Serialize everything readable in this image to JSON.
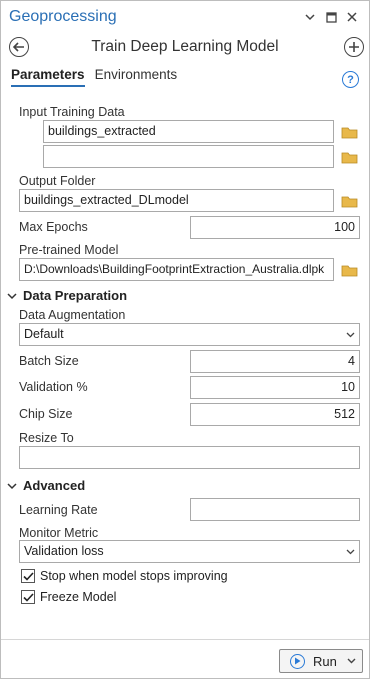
{
  "window": {
    "title": "Geoprocessing"
  },
  "tool": {
    "title": "Train Deep Learning Model"
  },
  "tabs": [
    "Parameters",
    "Environments"
  ],
  "params": {
    "input_training_data": {
      "label": "Input Training Data",
      "values": [
        "buildings_extracted",
        ""
      ]
    },
    "output_folder": {
      "label": "Output Folder",
      "value": "buildings_extracted_DLmodel"
    },
    "max_epochs": {
      "label": "Max Epochs",
      "value": "100"
    },
    "pretrained_model": {
      "label": "Pre-trained Model",
      "value": "D:\\Downloads\\BuildingFootprintExtraction_Australia.dlpk"
    }
  },
  "data_preparation": {
    "header": "Data Preparation",
    "data_augmentation": {
      "label": "Data Augmentation",
      "selected": "Default"
    },
    "batch_size": {
      "label": "Batch Size",
      "value": "4"
    },
    "validation": {
      "label": "Validation %",
      "value": "10"
    },
    "chip_size": {
      "label": "Chip Size",
      "value": "512"
    },
    "resize_to": {
      "label": "Resize To",
      "value": ""
    }
  },
  "advanced": {
    "header": "Advanced",
    "learning_rate": {
      "label": "Learning Rate",
      "value": ""
    },
    "monitor_metric": {
      "label": "Monitor Metric",
      "selected": "Validation loss"
    },
    "stop_improving": {
      "label": "Stop when model stops improving",
      "checked": true
    },
    "freeze_model": {
      "label": "Freeze Model",
      "checked": true
    }
  },
  "run": {
    "label": "Run"
  },
  "colors": {
    "accent": "#2a6fb5",
    "folder": "#e8b84a",
    "help": "#2a7ad6"
  },
  "icons": [
    "chevron-down-icon",
    "pin-icon",
    "close-icon",
    "back-icon",
    "add-icon",
    "help-icon",
    "folder-icon",
    "checkmark-icon",
    "play-icon"
  ]
}
